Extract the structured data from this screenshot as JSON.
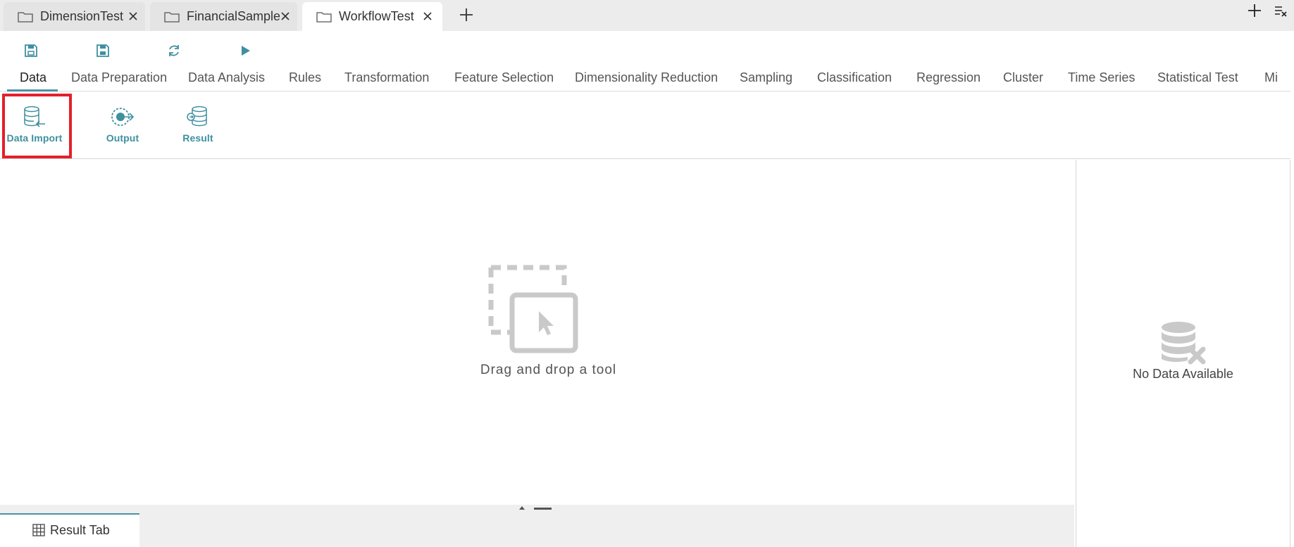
{
  "doc_tabs": [
    {
      "label": "DimensionTest",
      "active": false
    },
    {
      "label": "FinancialSample",
      "active": false
    },
    {
      "label": "WorkflowTest",
      "active": true
    }
  ],
  "quick_toolbar": [
    "save-icon",
    "save-as-icon",
    "refresh-icon",
    "run-icon"
  ],
  "category_tabs": [
    "Data",
    "Data Preparation",
    "Data Analysis",
    "Rules",
    "Transformation",
    "Feature Selection",
    "Dimensionality Reduction",
    "Sampling",
    "Classification",
    "Regression",
    "Cluster",
    "Time Series",
    "Statistical Test",
    "Mi"
  ],
  "active_category": "Data",
  "tools": [
    {
      "label": "Data Import",
      "icon": "database-import-icon"
    },
    {
      "label": "Output",
      "icon": "output-icon"
    },
    {
      "label": "Result",
      "icon": "database-result-icon"
    }
  ],
  "canvas": {
    "empty_text": "Drag and drop a tool"
  },
  "result_tab": {
    "label": "Result Tab"
  },
  "right_panel": {
    "empty_text": "No Data Available"
  },
  "colors": {
    "accent": "#4a93a3",
    "highlight": "#e3202a",
    "muted_icon": "#c9c9c9"
  }
}
